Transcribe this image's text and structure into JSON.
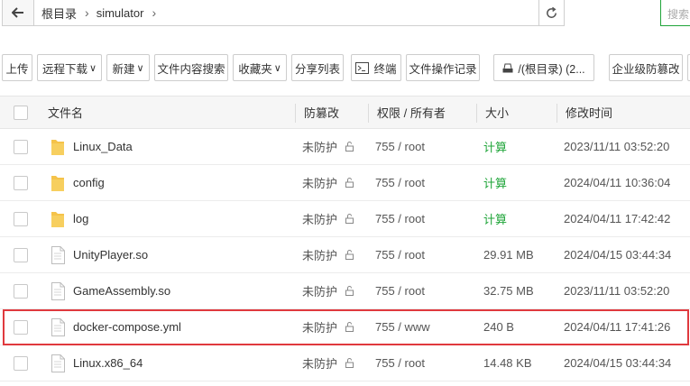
{
  "pathbar": {
    "crumbs": [
      "根目录",
      "simulator"
    ],
    "search_placeholder": "搜索"
  },
  "toolbar": {
    "upload": "上传",
    "remote_download": "远程下载",
    "new": "新建",
    "content_search": "文件内容搜索",
    "favorites": "收藏夹",
    "share_list": "分享列表",
    "terminal": "终端",
    "op_log": "文件操作记录",
    "disk": "/(根目录) (2...",
    "tamper": "企业级防篡改"
  },
  "table": {
    "headers": {
      "name": "文件名",
      "tamper": "防篡改",
      "perm": "权限 / 所有者",
      "size": "大小",
      "mtime": "修改时间"
    },
    "rows": [
      {
        "name": "Linux_Data",
        "type": "folder",
        "tamper": "未防护",
        "perm": "755 / root",
        "size": "计算",
        "mtime": "2023/11/11 03:52:20"
      },
      {
        "name": "config",
        "type": "folder",
        "tamper": "未防护",
        "perm": "755 / root",
        "size": "计算",
        "mtime": "2024/04/11 10:36:04"
      },
      {
        "name": "log",
        "type": "folder",
        "tamper": "未防护",
        "perm": "755 / root",
        "size": "计算",
        "mtime": "2024/04/11 17:42:42"
      },
      {
        "name": "UnityPlayer.so",
        "type": "file",
        "tamper": "未防护",
        "perm": "755 / root",
        "size": "29.91 MB",
        "mtime": "2024/04/15 03:44:34"
      },
      {
        "name": "GameAssembly.so",
        "type": "file",
        "tamper": "未防护",
        "perm": "755 / root",
        "size": "32.75 MB",
        "mtime": "2023/11/11 03:52:20"
      },
      {
        "name": "docker-compose.yml",
        "type": "file",
        "tamper": "未防护",
        "perm": "755 / www",
        "size": "240 B",
        "mtime": "2024/04/11 17:41:26"
      },
      {
        "name": "Linux.x86_64",
        "type": "file",
        "tamper": "未防护",
        "perm": "755 / root",
        "size": "14.48 KB",
        "mtime": "2024/04/15 03:44:34"
      }
    ]
  },
  "colors": {
    "accent": "#20a53a",
    "highlight": "#e0393e",
    "folder": "#f5c34a"
  }
}
